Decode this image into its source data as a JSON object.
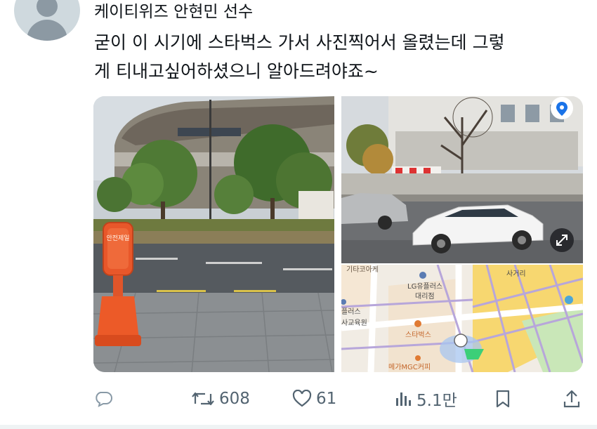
{
  "tweet": {
    "author_line": "케이티위즈 안현민 선수",
    "text_lines": [
      "굳이 이 시기에 스타벅스 가서 사진찍어서 올렸는데 그렇",
      "게 티내고싶어하셨으니 알아드려야죠~"
    ]
  },
  "media": {
    "left_photo": {
      "sign_text": "안전제일"
    },
    "street_view": {
      "location_pin_icon": "location-pin-icon",
      "expand_icon": "expand-icon"
    },
    "map": {
      "labels": {
        "top_cut": "기타코아케",
        "lg": "LG유플러스",
        "lg_branch": "대리점",
        "left_edge_1": "플러스",
        "left_edge_2": "사교육원",
        "starbucks": "스타벅스",
        "bottom": "메가MGC커피",
        "corner": "사거리"
      }
    }
  },
  "actions": {
    "reply_count": "",
    "retweet_count": "608",
    "like_count": "61",
    "view_count": "5.1만"
  }
}
